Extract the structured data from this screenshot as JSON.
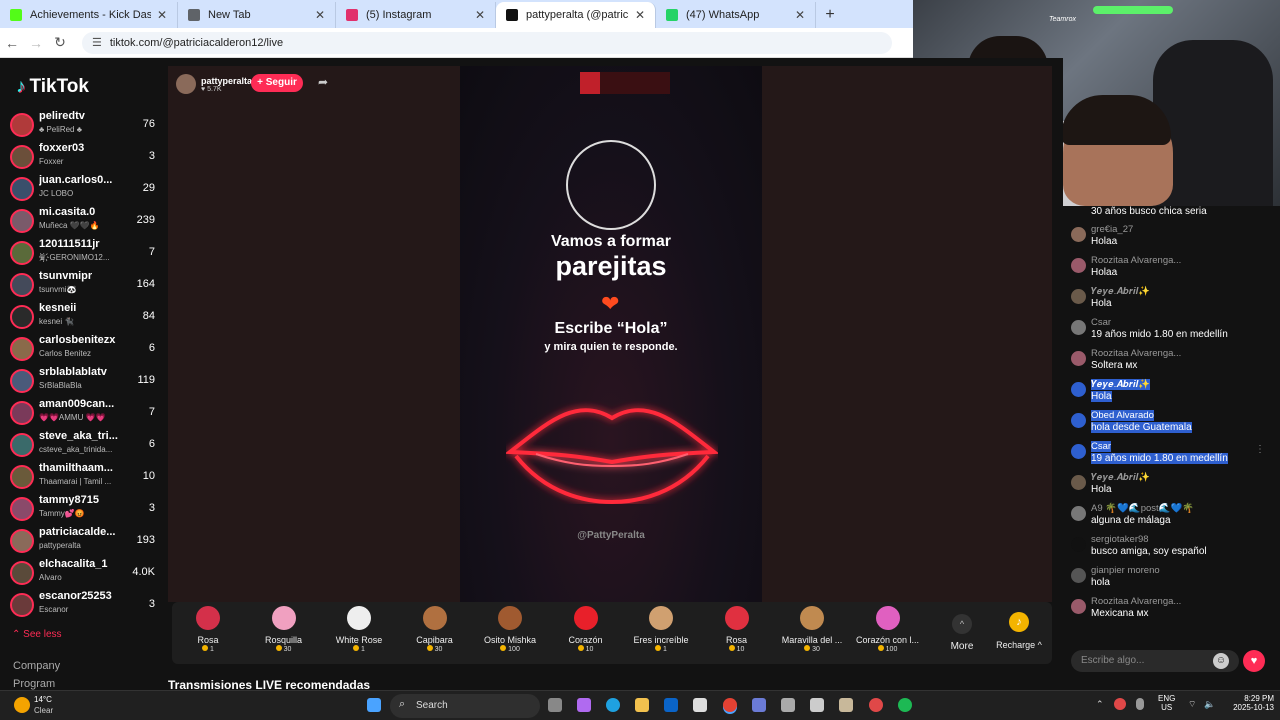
{
  "browser": {
    "tabs": [
      {
        "title": "Achievements - Kick Dashboard",
        "color": "#53fc18",
        "active": false
      },
      {
        "title": "New Tab",
        "color": "#5f6368",
        "active": false
      },
      {
        "title": "(5) Instagram",
        "color": "#e1306c",
        "active": false
      },
      {
        "title": "pattyperalta (@patriciacald",
        "color": "#111111",
        "active": true
      },
      {
        "title": "(47) WhatsApp",
        "color": "#25d366",
        "active": false
      }
    ],
    "close_glyph": "✕",
    "new_tab_glyph": "+",
    "url": "tiktok.com/@patriciacalderon12/live"
  },
  "sidebar": {
    "logo": "TikTok",
    "items": [
      {
        "name": "peliredtv",
        "sub": "♣ PeliRed ♣",
        "count": "76",
        "color": "#b03a3a"
      },
      {
        "name": "foxxer03",
        "sub": "Foxxer",
        "count": "3",
        "color": "#6b4f3a"
      },
      {
        "name": "juan.carlos0...",
        "sub": "JC LOBO",
        "count": "29",
        "color": "#3a4f6b"
      },
      {
        "name": "mi.casita.0",
        "sub": "Muñeca 🖤🖤🔥",
        "count": "239",
        "color": "#7a5a6a"
      },
      {
        "name": "120111511jr",
        "sub": "♛҉GERONIMO12...",
        "count": "7",
        "color": "#5a6a3a"
      },
      {
        "name": "tsunvmipr",
        "sub": "tsunvmi🐼",
        "count": "164",
        "color": "#444a5a"
      },
      {
        "name": "kesneii",
        "sub": "kesnei 🐈‍⬛",
        "count": "84",
        "color": "#2a2a2a"
      },
      {
        "name": "carlosbenitezx",
        "sub": "Carlos Benitez",
        "count": "6",
        "color": "#8a6a4a"
      },
      {
        "name": "srblablablatv",
        "sub": "SrBlaBlaBla",
        "count": "119",
        "color": "#4a5a7a"
      },
      {
        "name": "aman009can...",
        "sub": "💗💗AMMU 💗💗",
        "count": "7",
        "color": "#7a3a5a"
      },
      {
        "name": "steve_aka_tri...",
        "sub": "ᴄsteve_aka_trinida...",
        "count": "6",
        "color": "#3a6a6a"
      },
      {
        "name": "thamilthaam...",
        "sub": "Thaamarai | Tamil ...",
        "count": "10",
        "color": "#6a5a3a"
      },
      {
        "name": "tammy8715",
        "sub": "Tammy💕😡",
        "count": "3",
        "color": "#8a4a6a"
      },
      {
        "name": "patriciacalde...",
        "sub": "pattyperalta",
        "count": "193",
        "color": "#8a6a5a"
      },
      {
        "name": "elchacalita_1",
        "sub": "Alvaro",
        "count": "4.0K",
        "color": "#5a4a3a"
      },
      {
        "name": "escanor25253",
        "sub": "Escanor",
        "count": "3",
        "color": "#6a3a3a"
      }
    ],
    "see_less": "See less",
    "footer": [
      "Company",
      "Program"
    ]
  },
  "live": {
    "host_name": "pattyperalta",
    "host_viewers": "♥ 5.7K",
    "follow_label": "+ Seguir",
    "share_icon": "➦",
    "video_line1": "Vamos a formar",
    "video_line2": "parejitas",
    "video_line3": "Escribe “Hola”",
    "video_line4": "y mira quien te responde.",
    "video_tag": "@PattyPeralta",
    "heart": "❤",
    "recommended": "Transmisiones LIVE recomendadas"
  },
  "gifts": [
    {
      "name": "Rosa",
      "price": "1",
      "color": "#d4304a"
    },
    {
      "name": "Rosquilla",
      "price": "30",
      "color": "#f0a0c0"
    },
    {
      "name": "White Rose",
      "price": "1",
      "color": "#eeeeee"
    },
    {
      "name": "Capibara",
      "price": "30",
      "color": "#b07040"
    },
    {
      "name": "Osito Mishka",
      "price": "100",
      "color": "#a05a30"
    },
    {
      "name": "Corazón",
      "price": "10",
      "color": "#e8202a"
    },
    {
      "name": "Eres increíble",
      "price": "1",
      "color": "#d0a070"
    },
    {
      "name": "Rosa",
      "price": "10",
      "color": "#e03040"
    },
    {
      "name": "Maravilla del ...",
      "price": "30",
      "color": "#c08a50"
    },
    {
      "name": "Corazón con l...",
      "price": "100",
      "color": "#e060c0"
    }
  ],
  "gift_more": "More",
  "gift_more_icon": "^",
  "recharge": "Recharge ^",
  "recharge_icon": "♪",
  "chat": {
    "messages": [
      {
        "user": "",
        "text": "30 años busco chica seria",
        "color": "#444",
        "hl": false
      },
      {
        "user": "gre€ia_27",
        "text": "Holaa",
        "color": "#8a6a5a",
        "hl": false
      },
      {
        "user": "Roozitaa Alvarenga...",
        "text": "Holaa",
        "color": "#9a5a6a",
        "hl": false
      },
      {
        "user": "𝒀𝒆𝒚𝒆.𝑨𝒃𝒓𝒊𝒍✨",
        "text": "Hola",
        "color": "#6a5a4a",
        "hl": false
      },
      {
        "user": "Csar",
        "text": "19 años mido 1.80 en medellín",
        "color": "#777",
        "hl": false
      },
      {
        "user": "Roozitaa Alvarenga...",
        "text": "Soltera ᴍx",
        "color": "#9a5a6a",
        "hl": false
      },
      {
        "user": "𝒀𝒆𝒚𝒆.𝑨𝒃𝒓𝒊𝒍✨",
        "text": "Hola",
        "color": "#2e5fcf",
        "hl": true
      },
      {
        "user": "Obed Alvarado",
        "text": "hola desde Guatemala",
        "color": "#2e5fcf",
        "hl": true
      },
      {
        "user": "Csar",
        "text": "19 años mido 1.80 en medellín",
        "color": "#2e5fcf",
        "hl": true
      },
      {
        "user": "𝒀𝒆𝒚𝒆.𝑨𝒃𝒓𝒊𝒍✨",
        "text": "Hola",
        "color": "#6a5a4a",
        "hl": false
      },
      {
        "user": "A9 🌴💙🌊post🌊💙🌴",
        "text": "alguna de málaga",
        "color": "#777",
        "hl": false
      },
      {
        "user": "sergiotaker98",
        "text": "busco amiga, soy español",
        "color": "#111",
        "hl": false
      },
      {
        "user": "gianpier moreno",
        "text": "hola",
        "color": "#555",
        "hl": false
      },
      {
        "user": "Roozitaa Alvarenga...",
        "text": "Mexicana ᴍx",
        "color": "#9a5a6a",
        "hl": false
      }
    ],
    "input_placeholder": "Escribe algo...",
    "emoji_icon": "☺",
    "heart_icon": "♥"
  },
  "taskbar": {
    "temp": "14°C",
    "condition": "Clear",
    "search": "Search",
    "lang": "ENG",
    "region": "US",
    "time": "8:29 PM",
    "date": "2025-10-13"
  },
  "webcam_banner": "Teamrox"
}
